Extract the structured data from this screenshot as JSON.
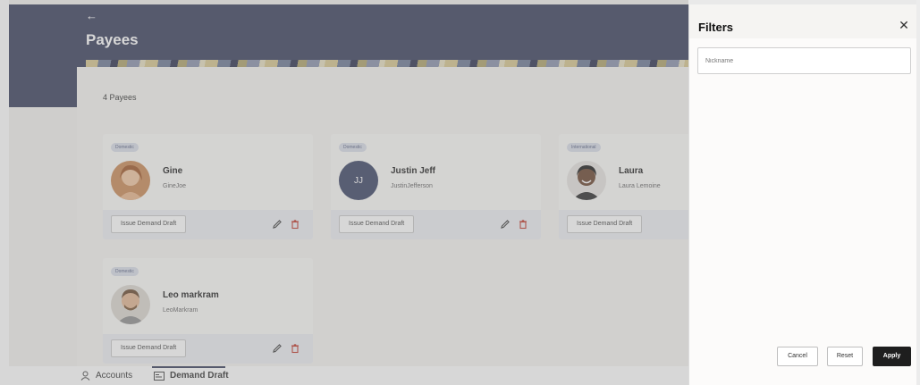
{
  "header": {
    "back_icon": "arrow-left-icon",
    "title": "Payees"
  },
  "payees": {
    "count_label": "4 Payees",
    "cards": [
      {
        "badge": "Domestic",
        "name": "Gine",
        "nickname": "GineJoe",
        "avatar": "photo",
        "button": "Issue Demand Draft"
      },
      {
        "badge": "Domestic",
        "name": "Justin Jeff",
        "nickname": "JustinJefferson",
        "avatar_initials": "JJ",
        "button": "Issue Demand Draft"
      },
      {
        "badge": "International",
        "name": "Laura",
        "nickname": "Laura Lemoine",
        "avatar": "photo",
        "button": "Issue Demand Draft"
      },
      {
        "badge": "Domestic",
        "name": "Leo markram",
        "nickname": "LeoMarkram",
        "avatar": "photo",
        "button": "Issue Demand Draft"
      }
    ]
  },
  "bottom_nav": {
    "items": [
      {
        "label": "Accounts",
        "icon": "user-icon"
      },
      {
        "label": "Demand Draft",
        "icon": "demand-draft-icon",
        "active": true
      }
    ]
  },
  "filters": {
    "title": "Filters",
    "close_icon": "close-icon",
    "nickname_placeholder": "Nickname",
    "nickname_value": "",
    "cancel_label": "Cancel",
    "reset_label": "Reset",
    "apply_label": "Apply"
  },
  "colors": {
    "header_bg": "#3a3f5c",
    "delete_red": "#c0392b",
    "apply_bg": "#1e1e1e",
    "badge_bg": "#d9dde9"
  }
}
